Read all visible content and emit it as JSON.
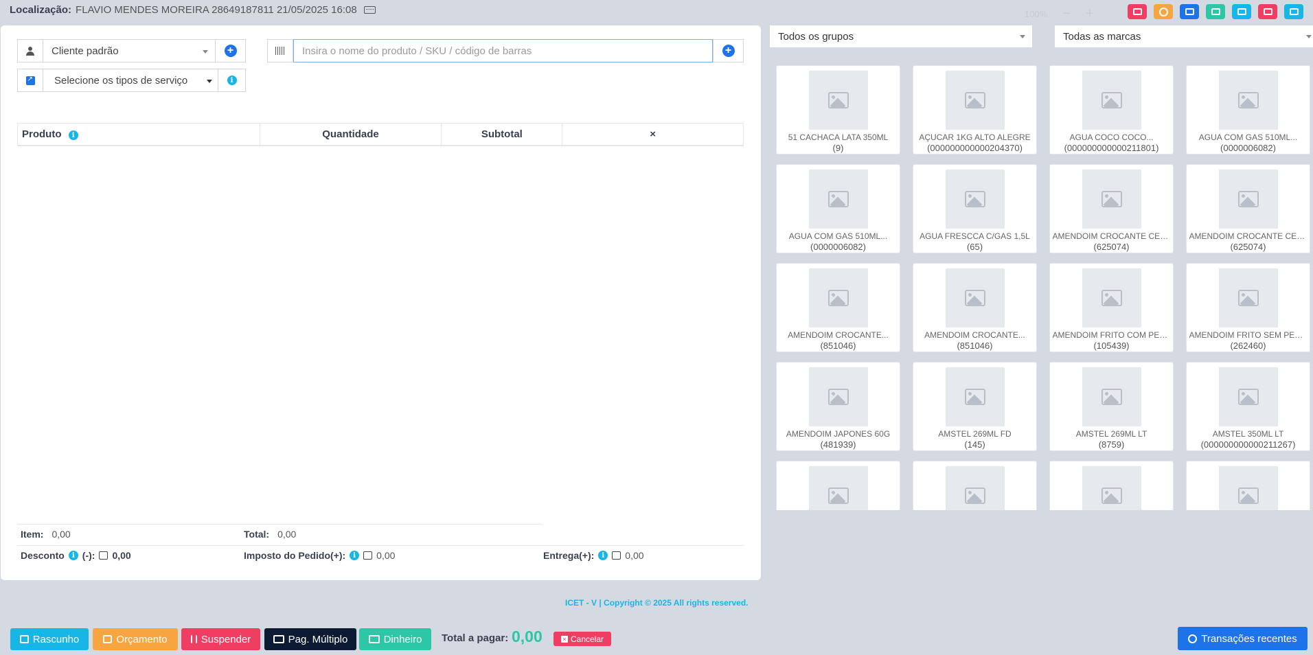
{
  "header": {
    "location_label": "Localização:",
    "location_value": "FLAVIO MENDES MOREIRA 28649187811 21/05/2025 16:08",
    "zoom": "100%",
    "zoom_minus": "−",
    "zoom_plus": "+",
    "icons": [
      {
        "name": "cash-register-icon",
        "color": "#f03e63"
      },
      {
        "name": "pause-icon",
        "color": "#f7a541"
      },
      {
        "name": "window-icon",
        "color": "#1e73e8"
      },
      {
        "name": "calculator-icon",
        "color": "#2dc7a7"
      },
      {
        "name": "briefcase-icon",
        "color": "#17b6e6"
      },
      {
        "name": "close-window-icon",
        "color": "#f03e63"
      },
      {
        "name": "backward-icon",
        "color": "#17b6e6"
      }
    ]
  },
  "form": {
    "customer_value": "Cliente padrão",
    "service_value": "Selecione os tipos de serviço",
    "search_placeholder": "Insira o nome do produto / SKU / código de barras"
  },
  "cart": {
    "columns": [
      "Produto",
      "Quantidade",
      "Subtotal",
      "×"
    ]
  },
  "totals": {
    "item_label": "Item:",
    "item_value": "0,00",
    "total_label": "Total:",
    "total_value": "0,00",
    "discount_label": "Desconto",
    "discount_sign": "(-):",
    "discount_value": "0,00",
    "tax_label": "Imposto do Pedido(+):",
    "tax_value": "0,00",
    "shipping_label": "Entrega(+):",
    "shipping_value": "0,00"
  },
  "copyright": "ICET - V | Copyright © 2025 All rights reserved.",
  "bottom": {
    "draft": "Rascunho",
    "quote": "Orçamento",
    "suspend": "Suspender",
    "multi_pay": "Pag. Múltiplo",
    "cash": "Dinheiro",
    "total_label": "Total a pagar:",
    "total_value": "0,00",
    "cancel": "Cancelar",
    "recent": "Transações recentes"
  },
  "filters": {
    "group": "Todos os grupos",
    "brand": "Todas as marcas"
  },
  "products": [
    {
      "name": "51 CACHACA LATA 350ML",
      "sku": "(9)"
    },
    {
      "name": "AÇUCAR 1KG ALTO ALEGRE",
      "sku": "(000000000000204370)"
    },
    {
      "name": "AGUA COCO COCO...",
      "sku": "(000000000000211801)"
    },
    {
      "name": "AGUA COM GAS 510ML...",
      "sku": "(0000006082)"
    },
    {
      "name": "AGUA COM GAS 510ML...",
      "sku": "(0000006082)"
    },
    {
      "name": "AGUA FRESCCA C/GAS 1,5L",
      "sku": "(65)"
    },
    {
      "name": "AMENDOIM CROCANTE CEBOL...",
      "sku": "(625074)"
    },
    {
      "name": "AMENDOIM CROCANTE CEBOL...",
      "sku": "(625074)"
    },
    {
      "name": "AMENDOIM CROCANTE...",
      "sku": "(851046)"
    },
    {
      "name": "AMENDOIM CROCANTE...",
      "sku": "(851046)"
    },
    {
      "name": "AMENDOIM FRITO COM PELE...",
      "sku": "(105439)"
    },
    {
      "name": "AMENDOIM FRITO SEM PELE...",
      "sku": "(262460)"
    },
    {
      "name": "AMENDOIM JAPONES 60G",
      "sku": "(481939)"
    },
    {
      "name": "AMSTEL 269ML FD",
      "sku": "(145)"
    },
    {
      "name": "AMSTEL 269ML LT",
      "sku": "(8759)"
    },
    {
      "name": "AMSTEL 350ML LT",
      "sku": "(000000000000211267)"
    },
    {
      "name": "",
      "sku": ""
    },
    {
      "name": "",
      "sku": ""
    },
    {
      "name": "",
      "sku": ""
    },
    {
      "name": "",
      "sku": ""
    }
  ]
}
